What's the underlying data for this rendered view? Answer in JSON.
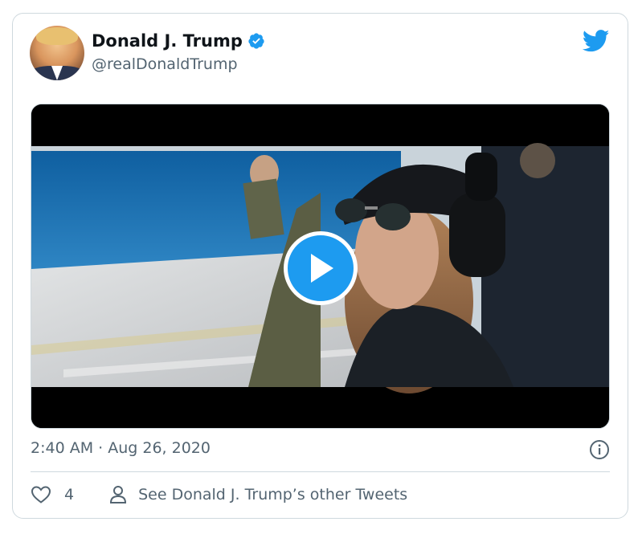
{
  "tweet": {
    "author": {
      "display_name": "Donald J. Trump",
      "handle": "@realDonaldTrump",
      "verified": true
    },
    "timestamp": "2:40 AM · Aug 26, 2020",
    "likes": "4",
    "other_tweets_link": "See Donald J. Trump’s other Tweets"
  },
  "icons": {
    "verified": "verified-badge-icon",
    "brand": "twitter-bird-icon",
    "play": "play-icon",
    "info": "info-icon",
    "like": "heart-icon",
    "profile": "person-icon"
  },
  "colors": {
    "brand_blue": "#1d9bf0",
    "text_secondary": "#536471",
    "border": "#cfd9de"
  }
}
